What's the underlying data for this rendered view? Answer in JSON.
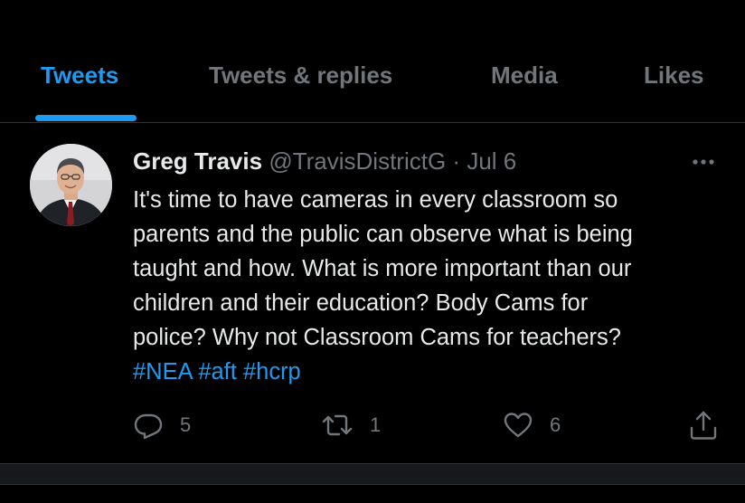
{
  "tabs": [
    {
      "label": "Tweets",
      "active": true
    },
    {
      "label": "Tweets & replies",
      "active": false
    },
    {
      "label": "Media",
      "active": false
    },
    {
      "label": "Likes",
      "active": false
    }
  ],
  "tweet": {
    "author_name": "Greg Travis",
    "handle": "@TravisDistrictG",
    "separator": "·",
    "date": "Jul 6",
    "lines": [
      "It's time to have cameras in every classroom so",
      "parents and the public can observe what is being",
      "taught and how.  What is more important than our",
      "children and their education? Body Cams for",
      "police?  Why not Classroom Cams for teachers?"
    ],
    "hashtags": [
      "#NEA",
      "#aft",
      "#hcrp"
    ],
    "replies": "5",
    "retweets": "1",
    "likes": "6"
  },
  "icons": {
    "more": "more-horizontal-icon",
    "reply": "reply-icon",
    "retweet": "retweet-icon",
    "like": "heart-icon",
    "share": "share-icon"
  },
  "colors": {
    "background": "#000000",
    "accent": "#1d9bf0",
    "text_primary": "#e7e9ea",
    "text_secondary": "#71767b",
    "divider": "#2f3336"
  }
}
